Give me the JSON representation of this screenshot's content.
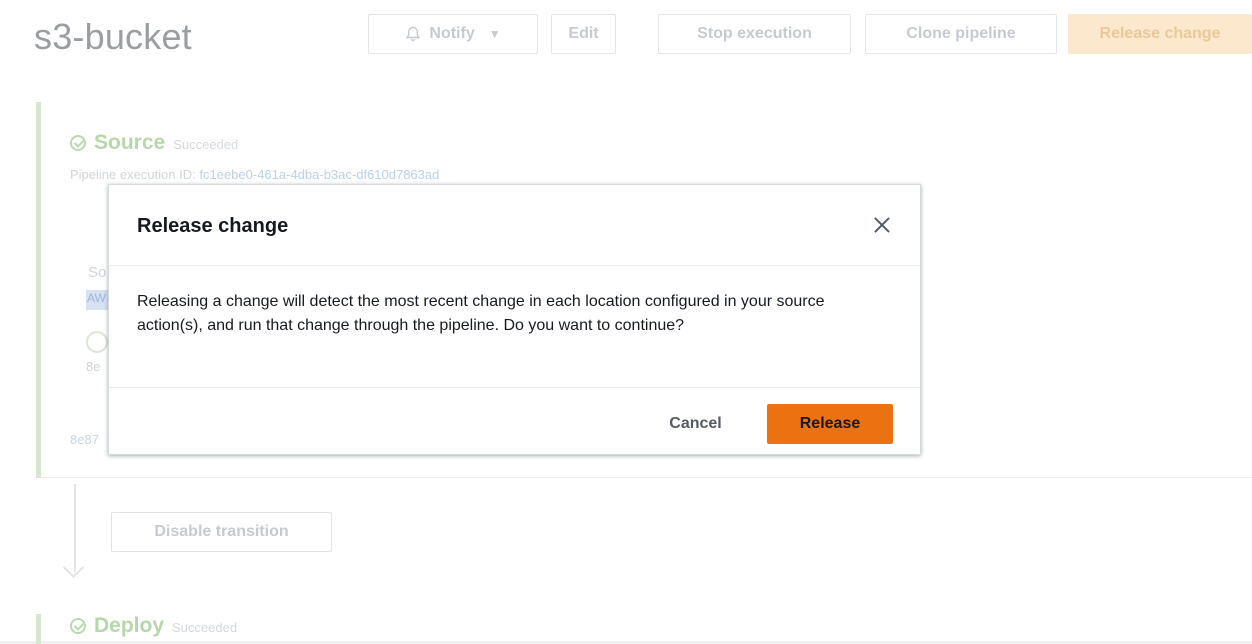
{
  "page": {
    "title": "s3-bucket",
    "toolbar": {
      "notify_label": "Notify",
      "edit_label": "Edit",
      "stop_label": "Stop execution",
      "clone_label": "Clone pipeline",
      "release_label": "Release change"
    }
  },
  "stages": [
    {
      "name": "Source",
      "status": "Succeeded",
      "execution_prefix": "Pipeline execution ID:",
      "execution_id": "fc1eebe0-461a-4dba-b3ac-df610d7863ad",
      "fragments": [
        "So",
        "AW",
        "8e",
        "8e87"
      ]
    },
    {
      "name": "Deploy",
      "status": "Succeeded"
    }
  ],
  "transition": {
    "disable_label": "Disable transition"
  },
  "modal": {
    "title": "Release change",
    "body": "Releasing a change will detect the most recent change in each location configured in your source action(s), and run that change through the pipeline. Do you want to continue?",
    "cancel_label": "Cancel",
    "release_label": "Release"
  },
  "colors": {
    "primary_button": "#ec7211",
    "success": "#b6d7ab",
    "text": "#16191f"
  }
}
